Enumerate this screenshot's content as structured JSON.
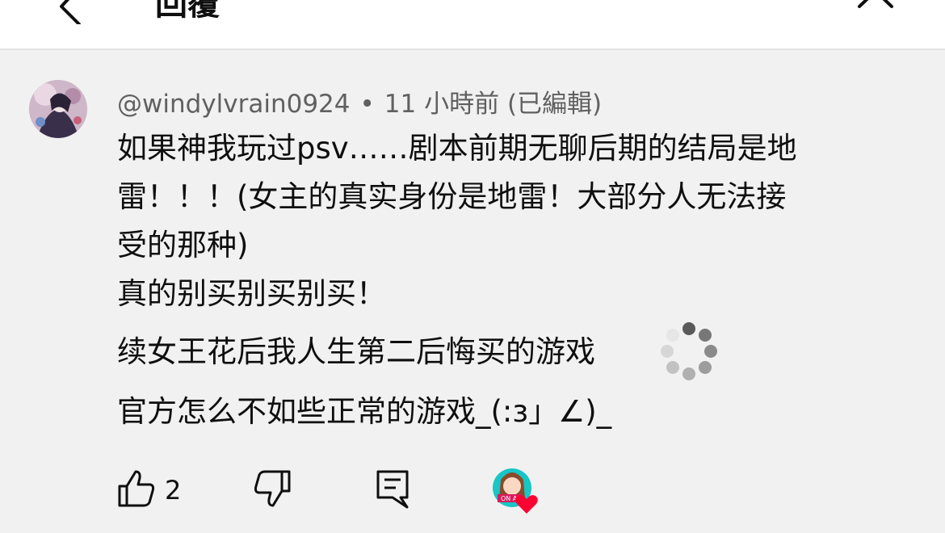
{
  "header": {
    "title": "回覆",
    "back_icon": "chevron-left-icon",
    "close_icon": "close-icon"
  },
  "comment": {
    "author": "@windylvrain0924",
    "separator": "•",
    "time": "11 小時前 (已編輯)",
    "lines": [
      "如果神我玩过psv……剧本前期无聊后期的结局是地",
      "雷！！！(女主的真实身份是地雷！大部分人无法接",
      "受的那种)",
      "真的别买别买别买！",
      "续女王花后我人生第二后悔买的游戏",
      "官方怎么不如些正常的游戏_(:з」∠)_"
    ],
    "like_count": "2",
    "creator_heart_badge": "ON AI"
  },
  "colors": {
    "header_bg": "#ffffff",
    "page_bg": "#f1f1f1",
    "text": "#0f0f0f",
    "meta_text": "#606060",
    "heart": "#ff0033"
  }
}
